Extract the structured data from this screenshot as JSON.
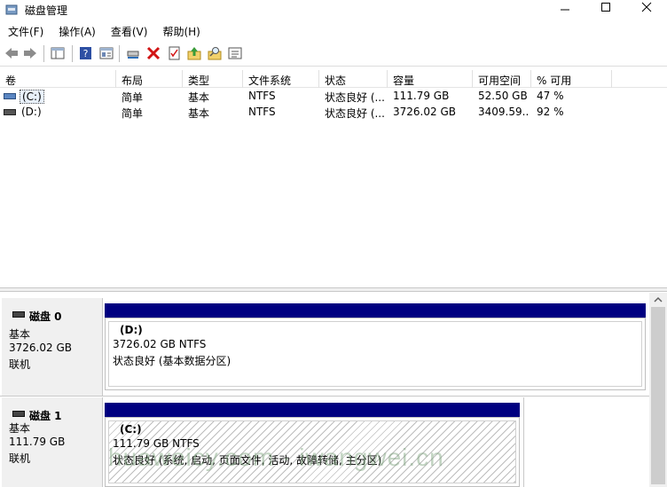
{
  "window": {
    "title": "磁盘管理",
    "controls": {
      "minimize": "minimize-icon",
      "maximize": "maximize-icon",
      "close": "close-icon"
    }
  },
  "menu": [
    "文件(F)",
    "操作(A)",
    "查看(V)",
    "帮助(H)"
  ],
  "toolbar_icons": [
    "back-arrow-icon",
    "forward-arrow-icon",
    "console-tree-icon",
    "help-icon",
    "properties-icon",
    "connect-drive-icon",
    "delete-icon",
    "checklist-icon",
    "folder-up-icon",
    "search-folder-icon",
    "list-view-icon"
  ],
  "volumes": {
    "columns": [
      "卷",
      "布局",
      "类型",
      "文件系统",
      "状态",
      "容量",
      "可用空间",
      "% 可用"
    ],
    "rows": [
      {
        "name": "(C:)",
        "layout": "简单",
        "type": "基本",
        "fs": "NTFS",
        "status": "状态良好 (...",
        "capacity": "111.79 GB",
        "free": "52.50 GB",
        "pct": "47 %"
      },
      {
        "name": "(D:)",
        "layout": "简单",
        "type": "基本",
        "fs": "NTFS",
        "status": "状态良好 (...",
        "capacity": "3726.02 GB",
        "free": "3409.59...",
        "pct": "92 %"
      }
    ]
  },
  "disks": [
    {
      "name": "磁盘 0",
      "type": "基本",
      "size": "3726.02 GB",
      "state": "联机",
      "partition": {
        "label": "(D:)",
        "size_fs": "3726.02 GB NTFS",
        "status": "状态良好 (基本数据分区)"
      }
    },
    {
      "name": "磁盘 1",
      "type": "基本",
      "size": "111.79 GB",
      "state": "联机",
      "partition": {
        "label": "(C:)",
        "size_fs": "111.79 GB NTFS",
        "status": "状态良好 (系统, 启动, 页面文件, 活动, 故障转储, 主分区)"
      }
    }
  ],
  "watermark": "huaweicy.com · iwangwei.cn",
  "colors": {
    "partition_bar": "#000080",
    "pane_bg": "#f0f0f0"
  }
}
